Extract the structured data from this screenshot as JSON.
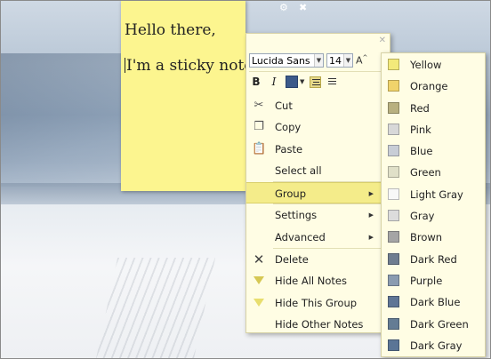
{
  "note": {
    "line1": "Hello there,",
    "line2": "I'm a sticky note.",
    "settings_icon": "gear-icon",
    "close_icon": "close-icon"
  },
  "menu": {
    "close_icon": "close-icon",
    "font": {
      "family": "Lucida Sans U",
      "size": "14",
      "grow_label": "A"
    },
    "format": {
      "bold": "B",
      "italic": "I",
      "text_color": "#3c5a8a"
    },
    "items": [
      {
        "label": "Cut",
        "icon": "scissors-icon"
      },
      {
        "label": "Copy",
        "icon": "copy-icon"
      },
      {
        "label": "Paste",
        "icon": "paste-icon"
      },
      {
        "label": "Select all",
        "icon": ""
      },
      {
        "label": "Group",
        "icon": "",
        "submenu": true,
        "highlighted": true
      },
      {
        "label": "Settings",
        "icon": "",
        "submenu": true
      },
      {
        "label": "Advanced",
        "icon": "",
        "submenu": true
      },
      {
        "label": "Delete",
        "icon": "delete-icon"
      },
      {
        "label": "Hide All Notes",
        "icon": "hide-all-icon"
      },
      {
        "label": "Hide This Group",
        "icon": "hide-group-icon"
      },
      {
        "label": "Hide Other Notes",
        "icon": ""
      }
    ]
  },
  "group_submenu": {
    "items": [
      {
        "label": "Yellow",
        "color": "#f3e97a"
      },
      {
        "label": "Orange",
        "color": "#f0d36b"
      },
      {
        "label": "Red",
        "color": "#b8b080"
      },
      {
        "label": "Pink",
        "color": "#d8d8d8"
      },
      {
        "label": "Blue",
        "color": "#c8cdd6"
      },
      {
        "label": "Green",
        "color": "#e0e0c8"
      },
      {
        "label": "Light Gray",
        "color": "#f8f8f8"
      },
      {
        "label": "Gray",
        "color": "#dcdcdc"
      },
      {
        "label": "Brown",
        "color": "#a5a5a5"
      },
      {
        "label": "Dark Red",
        "color": "#6f7d90"
      },
      {
        "label": "Purple",
        "color": "#8a9bb0"
      },
      {
        "label": "Dark Blue",
        "color": "#5f7595"
      },
      {
        "label": "Dark Green",
        "color": "#647c94"
      },
      {
        "label": "Dark Gray",
        "color": "#5b7596"
      }
    ]
  }
}
